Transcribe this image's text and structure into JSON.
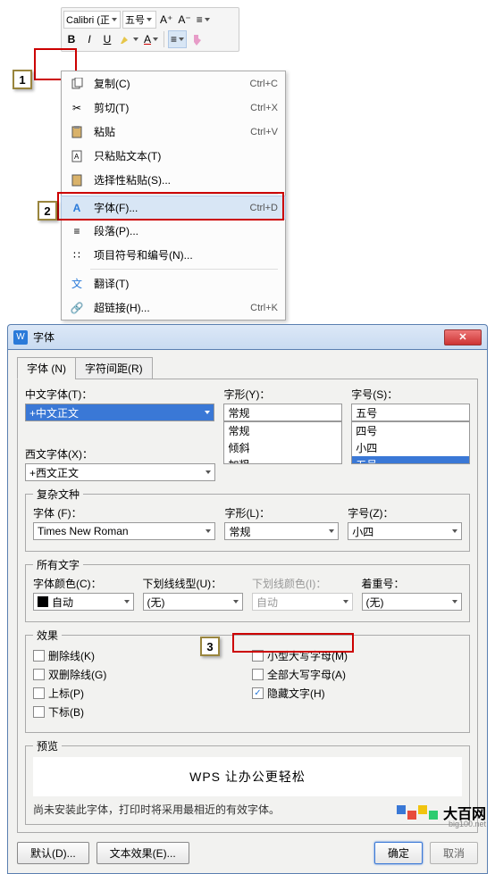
{
  "toolbar": {
    "font_name": "Calibri (正",
    "font_size": "五号",
    "inc_font": "A⁺",
    "dec_font": "A⁻",
    "bold": "B",
    "italic": "I",
    "underline": "U"
  },
  "callouts": {
    "c1": "1",
    "c2": "2",
    "c3": "3"
  },
  "menu": {
    "copy": {
      "label": "复制(C)",
      "shortcut": "Ctrl+C"
    },
    "cut": {
      "label": "剪切(T)",
      "shortcut": "Ctrl+X"
    },
    "paste": {
      "label": "粘贴",
      "shortcut": "Ctrl+V"
    },
    "paste_text": {
      "label": "只粘贴文本(T)",
      "shortcut": ""
    },
    "paste_special": {
      "label": "选择性粘贴(S)...",
      "shortcut": ""
    },
    "font": {
      "label": "字体(F)...",
      "shortcut": "Ctrl+D"
    },
    "paragraph": {
      "label": "段落(P)...",
      "shortcut": ""
    },
    "bullets": {
      "label": "项目符号和编号(N)...",
      "shortcut": ""
    },
    "translate": {
      "label": "翻译(T)",
      "shortcut": ""
    },
    "hyperlink": {
      "label": "超链接(H)...",
      "shortcut": "Ctrl+K"
    }
  },
  "dialog": {
    "title": "字体",
    "tabs": {
      "font": "字体 (N)",
      "spacing": "字符间距(R)"
    },
    "cn_font_label": "中文字体(T)：",
    "cn_font_value": "+中文正文",
    "style_label": "字形(Y)：",
    "style_value": "常规",
    "style_list": [
      "常规",
      "倾斜",
      "加粗"
    ],
    "size_label": "字号(S)：",
    "size_value": "五号",
    "size_list": [
      "四号",
      "小四",
      "五号"
    ],
    "west_font_label": "西文字体(X)：",
    "west_font_value": "+西文正文",
    "complex_legend": "复杂文种",
    "cfont_label": "字体 (F)：",
    "cfont_value": "Times New Roman",
    "cstyle_label": "字形(L)：",
    "cstyle_value": "常规",
    "csize_label": "字号(Z)：",
    "csize_value": "小四",
    "all_text_legend": "所有文字",
    "color_label": "字体颜色(C)：",
    "color_value": "自动",
    "ul_style_label": "下划线线型(U)：",
    "ul_style_value": "(无)",
    "ul_color_label": "下划线颜色(I)：",
    "ul_color_value": "自动",
    "emphasis_label": "着重号：",
    "emphasis_value": "(无)",
    "effects_legend": "效果",
    "fx": {
      "strike": "删除线(K)",
      "dblstrike": "双删除线(G)",
      "sup": "上标(P)",
      "sub": "下标(B)",
      "smallcaps": "小型大写字母(M)",
      "allcaps": "全部大写字母(A)",
      "hidden": "隐藏文字(H)"
    },
    "preview_legend": "预览",
    "preview_text": "WPS 让办公更轻松",
    "note": "尚未安装此字体，打印时将采用最相近的有效字体。",
    "btn_default": "默认(D)...",
    "btn_texteffect": "文本效果(E)...",
    "btn_ok": "确定",
    "btn_cancel": "取消"
  },
  "watermark": {
    "text": "大百网",
    "sub": "big100.net"
  }
}
